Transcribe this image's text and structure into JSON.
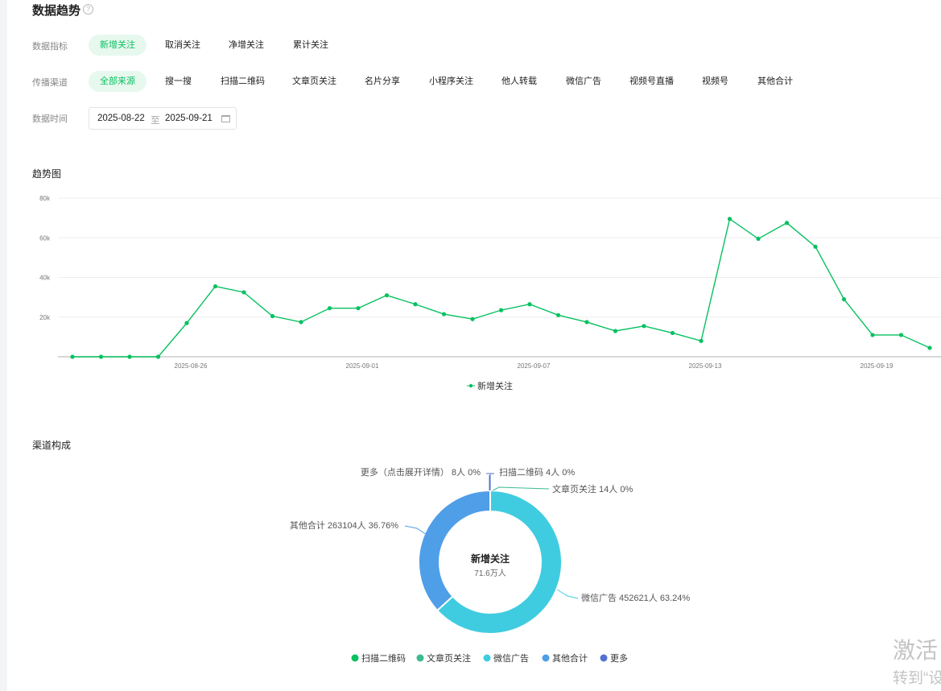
{
  "page": {
    "title": "数据趋势",
    "help_icon": "?"
  },
  "filters": {
    "metric_label": "数据指标",
    "metrics": [
      {
        "label": "新增关注",
        "active": true
      },
      {
        "label": "取消关注",
        "active": false
      },
      {
        "label": "净增关注",
        "active": false
      },
      {
        "label": "累计关注",
        "active": false
      }
    ],
    "channel_label": "传播渠道",
    "channels": [
      {
        "label": "全部来源",
        "active": true
      },
      {
        "label": "搜一搜",
        "active": false
      },
      {
        "label": "扫描二维码",
        "active": false
      },
      {
        "label": "文章页关注",
        "active": false
      },
      {
        "label": "名片分享",
        "active": false
      },
      {
        "label": "小程序关注",
        "active": false
      },
      {
        "label": "他人转载",
        "active": false
      },
      {
        "label": "微信广告",
        "active": false
      },
      {
        "label": "视频号直播",
        "active": false
      },
      {
        "label": "视频号",
        "active": false
      },
      {
        "label": "其他合计",
        "active": false
      }
    ],
    "time_label": "数据时间",
    "date_start": "2025-08-22",
    "date_sep": "至",
    "date_end": "2025-09-21"
  },
  "trend": {
    "title": "趋势图"
  },
  "composition": {
    "title": "渠道构成"
  },
  "chart_data": [
    {
      "type": "line",
      "title": "趋势图",
      "x": [
        "2025-08-22",
        "2025-08-23",
        "2025-08-24",
        "2025-08-25",
        "2025-08-26",
        "2025-08-27",
        "2025-08-28",
        "2025-08-29",
        "2025-08-30",
        "2025-08-31",
        "2025-09-01",
        "2025-09-02",
        "2025-09-03",
        "2025-09-04",
        "2025-09-05",
        "2025-09-06",
        "2025-09-07",
        "2025-09-08",
        "2025-09-09",
        "2025-09-10",
        "2025-09-11",
        "2025-09-12",
        "2025-09-13",
        "2025-09-14",
        "2025-09-15",
        "2025-09-16",
        "2025-09-17",
        "2025-09-18",
        "2025-09-19",
        "2025-09-20",
        "2025-09-21"
      ],
      "x_tick_labels": [
        "2025-08-26",
        "2025-09-01",
        "2025-09-07",
        "2025-09-13",
        "2025-09-19"
      ],
      "series": [
        {
          "name": "新增关注",
          "color": "#07c160",
          "values": [
            0,
            0,
            0,
            0,
            17000,
            35500,
            32500,
            20500,
            17500,
            24500,
            24500,
            31000,
            26500,
            21500,
            19000,
            23500,
            26500,
            21000,
            17500,
            13000,
            15500,
            12000,
            8000,
            69500,
            59500,
            67500,
            55500,
            29000,
            11000,
            11000,
            4500
          ]
        }
      ],
      "ylim": [
        0,
        80000
      ],
      "y_ticks": [
        "20k",
        "40k",
        "60k",
        "80k"
      ],
      "grid": true,
      "legend": "bottom"
    },
    {
      "type": "pie",
      "donut": true,
      "center_title": "新增关注",
      "center_value": "71.6万人",
      "slices": [
        {
          "name": "扫描二维码",
          "value": 4,
          "percent": "0%",
          "label": "扫描二维码 4人 0%",
          "color": "#07c160"
        },
        {
          "name": "文章页关注",
          "value": 14,
          "percent": "0%",
          "label": "文章页关注 14人 0%",
          "color": "#3cba92"
        },
        {
          "name": "微信广告",
          "value": 452621,
          "percent": "63.24%",
          "label": "微信广告 452621人 63.24%",
          "color": "#40cce0"
        },
        {
          "name": "其他合计",
          "value": 263104,
          "percent": "36.76%",
          "label": "其他合计 263104人 36.76%",
          "color": "#4f9ee8"
        },
        {
          "name": "更多",
          "value": 8,
          "percent": "0%",
          "label": "更多（点击展开详情） 8人 0%",
          "color": "#5470d0"
        }
      ],
      "legend": "bottom"
    }
  ],
  "watermark": {
    "line1": "激活",
    "line2": "转到“设"
  }
}
